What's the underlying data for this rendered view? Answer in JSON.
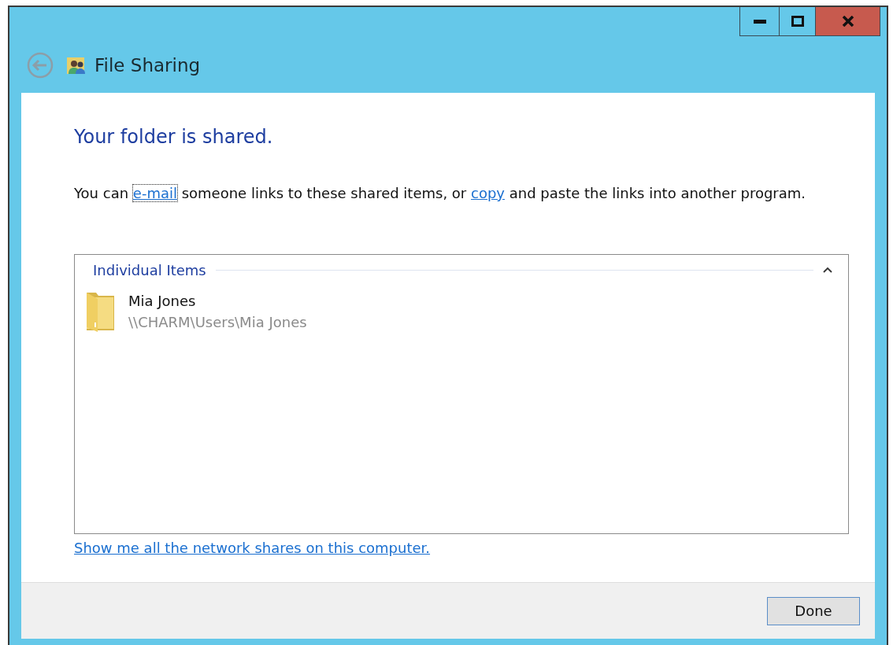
{
  "window": {
    "title": "File Sharing",
    "controls": [
      {
        "kind": "minimize"
      },
      {
        "kind": "maximize"
      },
      {
        "kind": "close"
      }
    ]
  },
  "heading": "Your folder is shared.",
  "intro": [
    {
      "kind": "text",
      "text": "You can "
    },
    {
      "kind": "link",
      "text": "e-mail",
      "focused": true
    },
    {
      "kind": "text",
      "text": " someone links to these shared items, or "
    },
    {
      "kind": "link",
      "text": "copy",
      "focused": false
    },
    {
      "kind": "text",
      "text": " and paste the links into another program."
    }
  ],
  "group": {
    "title": "Individual Items",
    "expanded": true,
    "items": [
      {
        "name": "Mia Jones",
        "path": "\\\\CHARM\\Users\\Mia Jones"
      }
    ]
  },
  "shares_link": "Show me all the network shares on this computer.",
  "buttons": [
    "Done"
  ]
}
